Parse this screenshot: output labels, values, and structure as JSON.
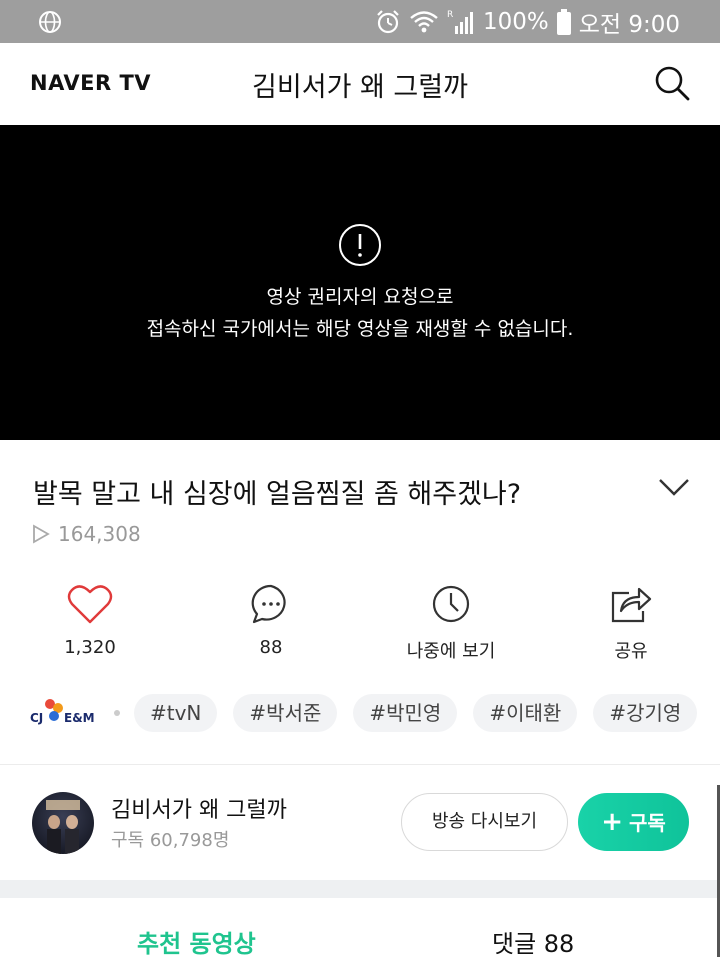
{
  "status_bar": {
    "battery": "100%",
    "time": "오전 9:00",
    "roaming_indicator": "R"
  },
  "header": {
    "logo": "NAVER TV",
    "title": "김비서가 왜 그럴까"
  },
  "video": {
    "message_line1": "영상 권리자의 요청으로",
    "message_line2": "접속하신 국가에서는 해당 영상을 재생할 수 없습니다."
  },
  "clip": {
    "title": "발목 말고 내 심장에 얼음찜질 좀 해주겠나?",
    "play_count": "164,308"
  },
  "actions": [
    {
      "label": "1,320",
      "icon": "heart-icon"
    },
    {
      "label": "88",
      "icon": "comment-icon"
    },
    {
      "label": "나중에 보기",
      "icon": "clock-icon"
    },
    {
      "label": "공유",
      "icon": "share-icon"
    }
  ],
  "tags": {
    "provider_logo": "CJ E&M",
    "provider_logo_cj": "CJ",
    "provider_logo_em": "E&M",
    "items": [
      "#tvN",
      "#박서준",
      "#박민영",
      "#이태환",
      "#강기영"
    ]
  },
  "channel": {
    "name": "김비서가 왜 그럴까",
    "subscribers": "구독 60,798명",
    "replay_label": "방송 다시보기",
    "subscribe_label": "구독",
    "subscribe_plus": "+"
  },
  "tabs": {
    "recommended": "추천 동영상",
    "comments": "댓글 88"
  },
  "colors": {
    "status_bar": "#9e9e9e",
    "accent_green": "#1fc48e",
    "heart_red": "#e03a3a"
  }
}
